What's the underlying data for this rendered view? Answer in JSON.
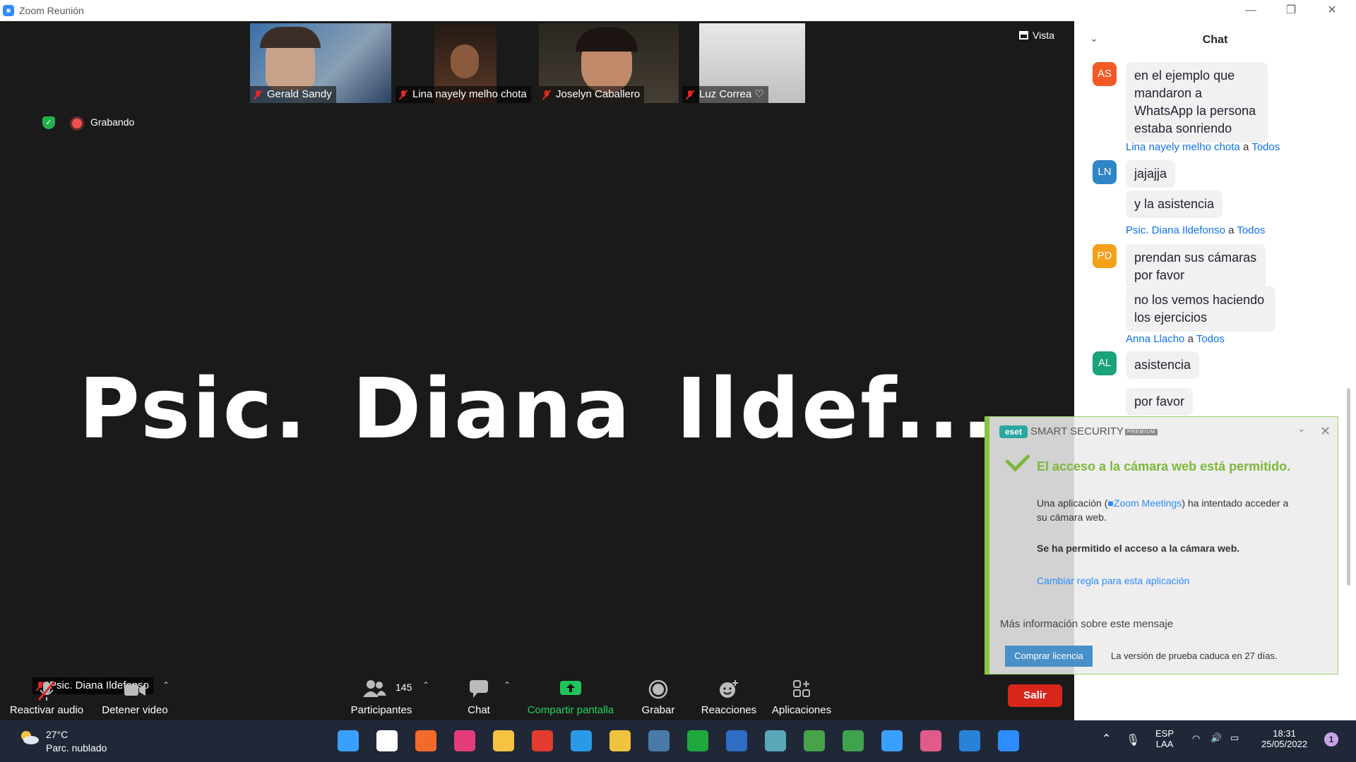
{
  "window": {
    "title": "Zoom Reunión"
  },
  "top_bar": {
    "view_label": "Vista",
    "recording_label": "Grabando"
  },
  "participants_strip": [
    {
      "name": "Gerald Sandy"
    },
    {
      "name": "Lina nayely melho chota"
    },
    {
      "name": "Joselyn Caballero"
    },
    {
      "name": "Luz Correa"
    }
  ],
  "active_speaker": {
    "big_name": "Psic. Diana Ildef...",
    "tag": "Psic. Diana Ildefonso"
  },
  "toolbar": {
    "audio_label": "Reactivar audio",
    "video_label": "Detener video",
    "participants_label": "Participantes",
    "participants_count": "145",
    "chat_label": "Chat",
    "share_label": "Compartir pantalla",
    "record_label": "Grabar",
    "reactions_label": "Reacciones",
    "apps_label": "Aplicaciones",
    "leave_label": "Salir"
  },
  "chat": {
    "title": "Chat",
    "to_word": "a",
    "messages": [
      {
        "initials": "AS",
        "color": "#f15a24",
        "sender": "",
        "recipient": "",
        "texts": [
          "en el ejemplo que mandaron a WhatsApp  la persona estaba sonriendo"
        ]
      },
      {
        "initials": "LN",
        "color": "#2f86c6",
        "sender": "Lina nayely melho chota",
        "recipient": "Todos",
        "texts": [
          "jajajja",
          "y la asistencia"
        ]
      },
      {
        "initials": "PD",
        "color": "#f5a01a",
        "sender": "Psic. Diana Ildefonso",
        "recipient": "Todos",
        "texts": [
          "prendan sus cámaras por favor",
          "no los vemos haciendo los ejercicios"
        ]
      },
      {
        "initials": "AL",
        "color": "#1aa27a",
        "sender": "Anna Llacho",
        "recipient": "Todos",
        "texts": [
          "asistencia",
          "por favor"
        ]
      }
    ]
  },
  "eset": {
    "product": "SMART SECURITY",
    "tier": "PREMIUM",
    "logo": "eset",
    "heading": "El acceso a la cámara web está permitido.",
    "body_prefix": "Una aplicación (",
    "app_name": "Zoom Meetings",
    "body_suffix": ") ha intentado acceder a su cámara web.",
    "allowed": "Se ha permitido el acceso a la cámara web.",
    "change_rule": "Cambiar regla para esta aplicación",
    "more_info": "Más información sobre este mensaje",
    "buy": "Comprar licencia",
    "trial": "La versión de prueba caduca en 27 días."
  },
  "taskbar": {
    "temperature": "27°C",
    "weather": "Parc. nublado",
    "lang_top": "ESP",
    "lang_bottom": "LAA",
    "time": "18:31",
    "date": "25/05/2022",
    "notifications": "1",
    "apps": [
      {
        "name": "windows-start-icon",
        "color": "#3aa0ff"
      },
      {
        "name": "search-icon",
        "color": "#ffffff"
      },
      {
        "name": "app-orange-icon",
        "color": "#f26b2c"
      },
      {
        "name": "intellij-icon",
        "color": "#e43b7a"
      },
      {
        "name": "file-explorer-icon",
        "color": "#f5c242"
      },
      {
        "name": "chrome-icon",
        "color": "#e33b2e"
      },
      {
        "name": "vscode-icon",
        "color": "#2a9ae8"
      },
      {
        "name": "git-icon",
        "color": "#f0c33c"
      },
      {
        "name": "mysql-workbench-icon",
        "color": "#4a7aa8"
      },
      {
        "name": "xbox-icon",
        "color": "#1fa83d"
      },
      {
        "name": "word-icon",
        "color": "#2f6cc4"
      },
      {
        "name": "app-teal-icon",
        "color": "#58a8b8"
      },
      {
        "name": "app-green-icon",
        "color": "#48a24a"
      },
      {
        "name": "mongodb-icon",
        "color": "#3fa34d"
      },
      {
        "name": "notepad-icon",
        "color": "#3aa0ff"
      },
      {
        "name": "snipping-tool-icon",
        "color": "#e05b8a"
      },
      {
        "name": "photos-icon",
        "color": "#2a82d8"
      },
      {
        "name": "zoom-icon",
        "color": "#2d8cff"
      }
    ]
  }
}
